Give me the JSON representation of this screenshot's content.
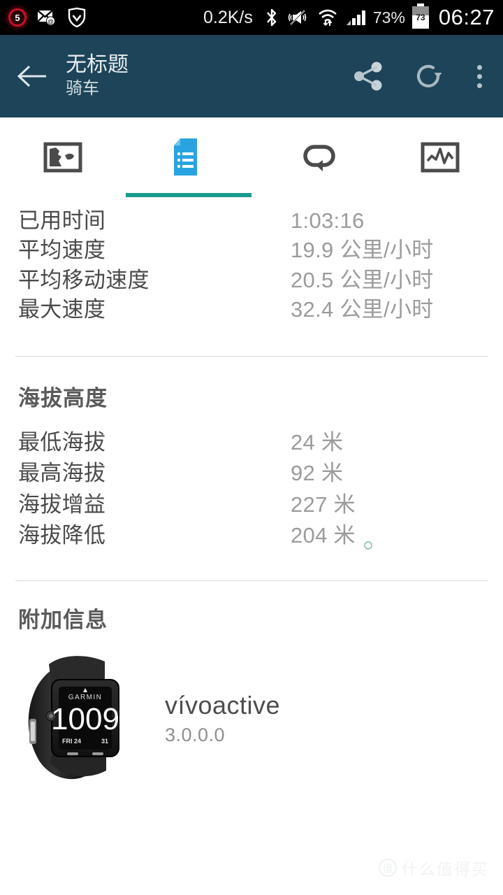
{
  "status_bar": {
    "notification_badge": "5",
    "network_speed": "0.2K/s",
    "battery_percent": "73%",
    "battery_level_label": "73",
    "time": "06:27",
    "icons": [
      "notification-badge-icon",
      "mail-at-icon",
      "shield-icon",
      "bluetooth-icon",
      "mute-vibrate-icon",
      "wifi-icon",
      "cell-signal-icon",
      "battery-icon"
    ]
  },
  "header": {
    "back_icon": "arrow-left-icon",
    "title": "无标题",
    "subtitle": "骑车",
    "share_icon": "share-icon",
    "refresh_icon": "refresh-icon",
    "overflow_icon": "more-vertical-icon",
    "accent_color": "#1d4459"
  },
  "tabs": {
    "selected_index": 1,
    "indicator_color": "#1a9a8e",
    "selected_icon_color": "#29a4e0",
    "items": [
      {
        "name": "map",
        "icon": "map-icon"
      },
      {
        "name": "details",
        "icon": "document-list-icon"
      },
      {
        "name": "laps",
        "icon": "lap-loop-icon"
      },
      {
        "name": "charts",
        "icon": "line-chart-icon"
      }
    ]
  },
  "stats": {
    "rows": [
      {
        "label": "已用时间",
        "value": "1:03:16"
      },
      {
        "label": "平均速度",
        "value": "19.9 公里/小时"
      },
      {
        "label": "平均移动速度",
        "value": "20.5 公里/小时"
      },
      {
        "label": "最大速度",
        "value": "32.4 公里/小时"
      }
    ]
  },
  "elevation": {
    "title": "海拔高度",
    "rows": [
      {
        "label": "最低海拔",
        "value": "24 米"
      },
      {
        "label": "最高海拔",
        "value": "92 米"
      },
      {
        "label": "海拔增益",
        "value": "227 米"
      },
      {
        "label": "海拔降低",
        "value": "204 米"
      }
    ]
  },
  "additional": {
    "title": "附加信息",
    "device_image": "garmin-vivoactive-watch-photo",
    "device_watch_face": {
      "brand": "GARMIN",
      "time": "10 09",
      "date": "FRI 24",
      "right_value": "31"
    },
    "device_name": "vívoactive",
    "device_version": "3.0.0.0"
  },
  "watermark": {
    "mark": "值",
    "text": "什么值得买"
  }
}
